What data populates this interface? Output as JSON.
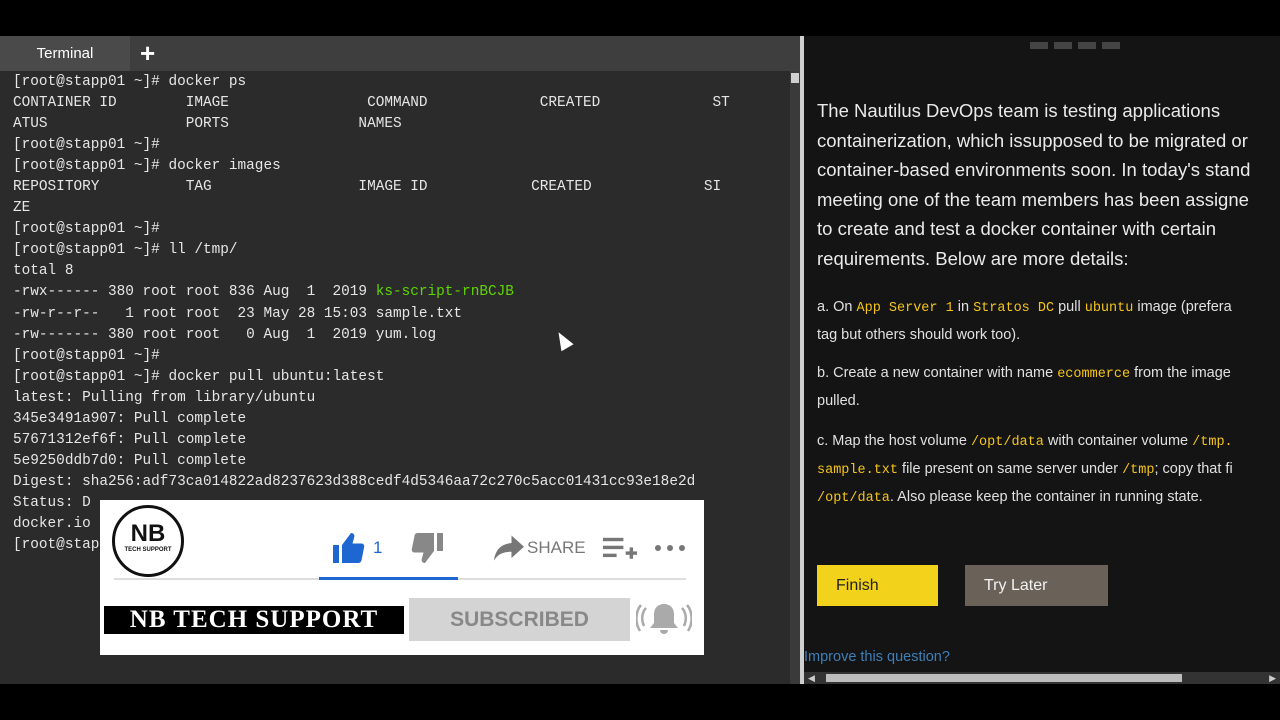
{
  "terminal": {
    "tab_label": "Terminal",
    "new_tab_symbol": "+",
    "lines": [
      "[root@stapp01 ~]# docker ps",
      "CONTAINER ID        IMAGE                COMMAND             CREATED             ST",
      "ATUS                PORTS               NAMES",
      "[root@stapp01 ~]#",
      "[root@stapp01 ~]# docker images",
      "REPOSITORY          TAG                 IMAGE ID            CREATED             SI",
      "ZE",
      "[root@stapp01 ~]#",
      "[root@stapp01 ~]# ll /tmp/",
      "total 8",
      "-rwx------ 380 root root 836 Aug  1  2019 ",
      "-rw-r--r--   1 root root  23 May 28 15:03 sample.txt",
      "-rw------- 380 root root   0 Aug  1  2019 yum.log",
      "[root@stapp01 ~]#",
      "[root@stapp01 ~]# docker pull ubuntu:latest",
      "latest: Pulling from library/ubuntu",
      "345e3491a907: Pull complete",
      "57671312ef6f: Pull complete",
      "5e9250ddb7d0: Pull complete",
      "Digest: sha256:adf73ca014822ad8237623d388cedf4d5346aa72c270c5acc01431cc93e18e2d",
      "Status: D",
      "docker.io",
      "[root@stap"
    ],
    "highlighted_file": "ks-script-rnBCJB"
  },
  "question": {
    "intro": "The Nautilus DevOps team is testing applications\ncontainerization, which issupposed to be migrated or\ncontainer-based environments soon. In today's stand\nmeeting one of the team members has been assigne\nto create and test a docker container with certain\nrequirements. Below are more details:",
    "step_a": {
      "t1": "a. On ",
      "c1": "App Server 1",
      "t2": " in ",
      "c2": "Stratos DC",
      "t3": " pull ",
      "c3": "ubuntu",
      "t4": " image (prefera",
      "l2": "tag but others should work too)."
    },
    "step_b": {
      "t1": "b. Create a new container with name ",
      "c1": "ecommerce",
      "t2": " from the image",
      "l2": "pulled."
    },
    "step_c": {
      "t1": "c. Map the host volume ",
      "c1": "/opt/data",
      "t2": " with container volume ",
      "c2": "/tmp.",
      "c3": "sample.txt",
      "t3": " file present on same server under ",
      "c4": "/tmp",
      "t4": "; copy that fi",
      "c5": "/opt/data",
      "t5": ". Also please keep the container in running state."
    },
    "finish_label": "Finish",
    "try_later_label": "Try Later",
    "improve_link": "Improve this question?"
  },
  "overlay": {
    "logo_text": "NB",
    "logo_subtext": "TECH SUPPORT",
    "like_count": "1",
    "share_label": "SHARE",
    "channel_name": "NB TECH SUPPORT",
    "subscribed_label": "SUBSCRIBED"
  },
  "colors": {
    "highlight_green": "#5fd400",
    "code_yellow": "#f5c518",
    "finish_yellow": "#f3d21b",
    "like_blue": "#1e67d0",
    "link_blue": "#3d7fb8"
  }
}
